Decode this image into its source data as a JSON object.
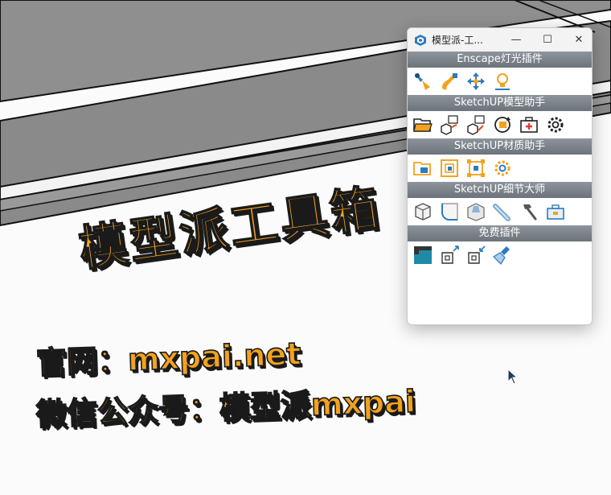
{
  "window": {
    "title": "模型派-工...",
    "app_icon": "sketchup-logo-icon",
    "controls": {
      "minimize": "—",
      "maximize": "☐",
      "close": "✕"
    }
  },
  "sections": [
    {
      "title": "Enscape灯光插件",
      "tools": [
        "spot-light-icon",
        "strip-light-icon",
        "move-light-icon",
        "bulb-settings-icon"
      ]
    },
    {
      "title": "SketchUP模型助手",
      "tools": [
        "open-folder-icon",
        "image-to-model-icon",
        "image-import-icon",
        "refresh-image-icon",
        "add-toolbox-icon",
        "gear-icon"
      ]
    },
    {
      "title": "SketchUP材质助手",
      "tools": [
        "material-folder-icon",
        "material-frame-icon",
        "material-select-icon",
        "material-gear-icon"
      ]
    },
    {
      "title": "SketchUP细节大师",
      "tools": [
        "cube-detail-icon",
        "fillet-edge-icon",
        "chamfer-icon",
        "pipe-icon",
        "hammer-icon",
        "detail-toolbox-icon"
      ]
    },
    {
      "title": "免费插件",
      "tools": [
        "monitor-icon",
        "export-box-icon",
        "import-box-icon",
        "cleanup-brush-icon"
      ]
    }
  ],
  "promo": {
    "title": "模型派工具箱",
    "site": "官网：mxpai.net",
    "wechat": "微信公众号：模型派mxpai"
  },
  "colors": {
    "accent_orange": "#f4a21c",
    "icon_blue": "#2e7bbf",
    "header_gray": "#737a82"
  }
}
